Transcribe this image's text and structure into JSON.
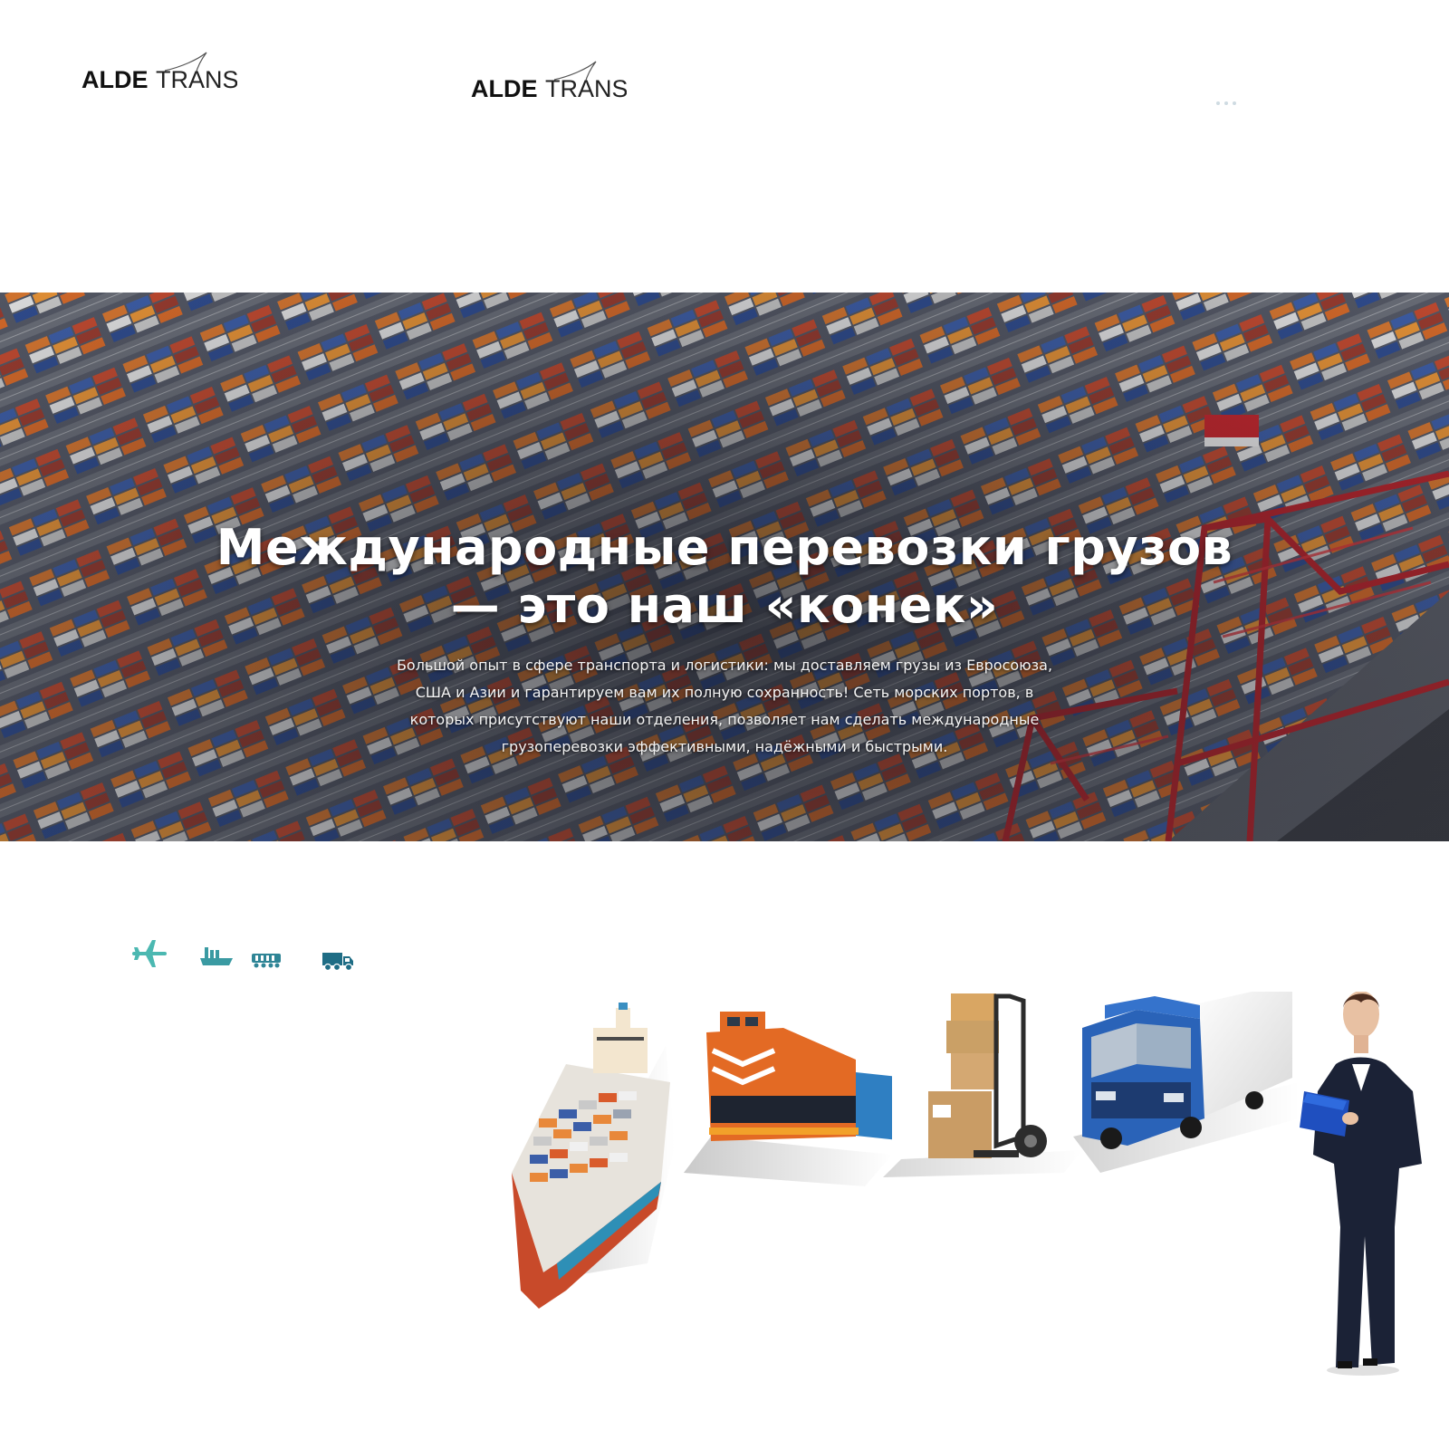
{
  "header": {
    "logo_primary": {
      "bold": "ALDE",
      "light": "TRANS"
    },
    "logo_secondary": {
      "bold": "ALDE",
      "light": "TRANS"
    },
    "slider_dots": 3
  },
  "hero": {
    "title_line1": "Международные перевозки грузов",
    "title_line2": "— это наш «конек»",
    "text_line1": "Большой опыт в сфере транспорта и логистики: мы доставляем грузы из Евросоюза,",
    "text_line2": "США и Азии и гарантируем вам их полную сохранность! Сеть морских портов, в",
    "text_line3": "которых присутствуют наши отделения, позволяет нам сделать международные",
    "text_line4": "грузоперевозки эффективными, надёжными и быстрыми.",
    "background": "container-port-aerial"
  },
  "transport_icons": [
    {
      "icon": "plane-icon",
      "color": "#4bb8b1"
    },
    {
      "icon": "ship-icon",
      "color": "#3a9aa2"
    },
    {
      "icon": "train-icon",
      "color": "#2f8596"
    },
    {
      "icon": "truck-icon",
      "color": "#1f6d85"
    }
  ],
  "illustration": {
    "items": [
      "cargo-ship",
      "locomotive",
      "boxes-hand-truck",
      "truck",
      "businesswoman"
    ]
  },
  "colors": {
    "accent": "#3a9aa2",
    "hero_overlay": "#20222c",
    "crane_red": "#b8232a"
  }
}
